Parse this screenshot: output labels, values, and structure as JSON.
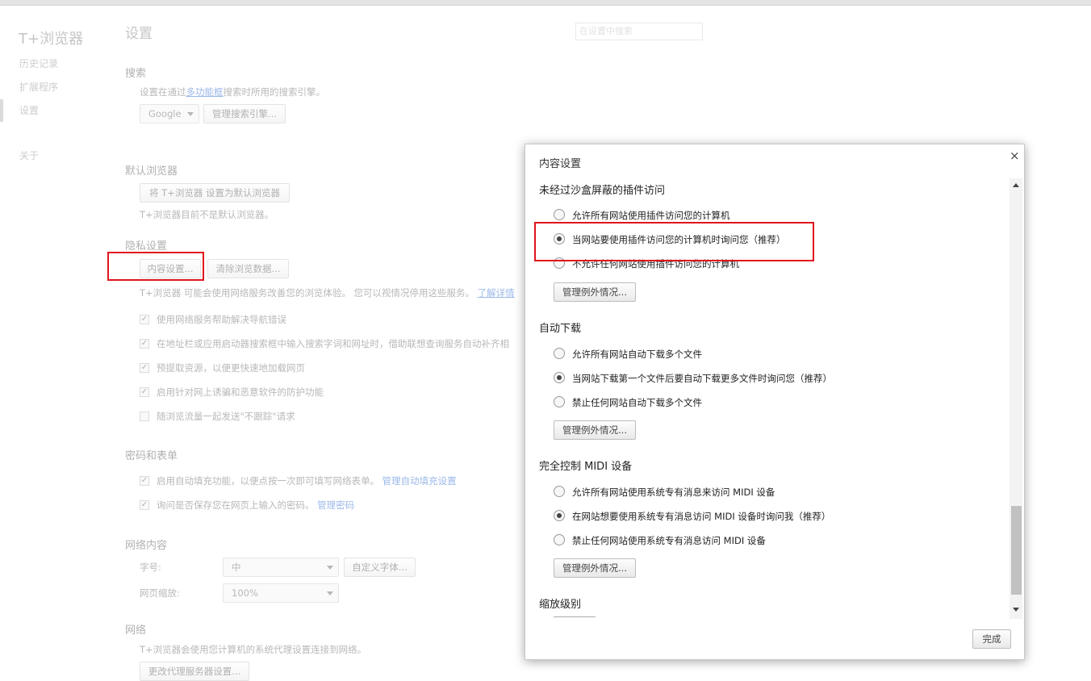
{
  "app": {
    "brand": "T+浏览器"
  },
  "sidebar": {
    "items": [
      "历史记录",
      "扩展程序",
      "设置",
      "关于"
    ]
  },
  "page": {
    "title": "设置",
    "search_placeholder": "在设置中搜索"
  },
  "search_section": {
    "title": "搜索",
    "desc_pre": "设置在通过",
    "desc_link": "多功能框",
    "desc_post": "搜索时所用的搜索引擎。",
    "engine": "Google",
    "manage": "管理搜索引擎..."
  },
  "default_browser": {
    "title": "默认浏览器",
    "button": "将 T+浏览器 设置为默认浏览器",
    "status": "T+浏览器目前不是默认浏览器。"
  },
  "privacy": {
    "title": "隐私设置",
    "content_settings": "内容设置...",
    "clear_data": "清除浏览数据...",
    "desc": "T+浏览器 可能会使用网络服务改善您的浏览体验。 您可以视情况停用这些服务。",
    "desc_link": "了解详情",
    "options": [
      {
        "label": "使用网络服务帮助解决导航错误",
        "checked": true
      },
      {
        "label": "在地址栏或应用启动器搜索框中输入搜索字词和网址时，借助联想查询服务自动补齐相",
        "checked": true
      },
      {
        "label": "预提取资源，以便更快速地加载网页",
        "checked": true
      },
      {
        "label": "启用针对网上诱骗和恶意软件的防护功能",
        "checked": true
      },
      {
        "label": "随浏览流量一起发送\"不跟踪\"请求",
        "checked": false
      }
    ]
  },
  "passwords": {
    "title": "密码和表单",
    "autofill": "启用自动填充功能，以便点按一次即可填写网络表单。",
    "autofill_link": "管理自动填充设置",
    "save_pw": "询问是否保存您在网页上输入的密码。",
    "save_pw_link": "管理密码"
  },
  "web_content": {
    "title": "网络内容",
    "font_size_label": "字号:",
    "font_size_value": "中",
    "custom_fonts": "自定义字体...",
    "zoom_label": "网页缩放:",
    "zoom_value": "100%"
  },
  "network": {
    "title": "网络",
    "desc": "T+浏览器会使用您计算机的系统代理设置连接到网络。",
    "proxy": "更改代理服务器设置..."
  },
  "dialog": {
    "title": "内容设置",
    "close": "×",
    "done": "完成",
    "manage_label": "管理例外情况...",
    "sections": [
      {
        "title": "未经过沙盒屏蔽的插件访问",
        "options": [
          {
            "label": "允许所有网站使用插件访问您的计算机",
            "selected": false
          },
          {
            "label": "当网站要使用插件访问您的计算机时询问您（推荐）",
            "selected": true
          },
          {
            "label": "不允许任何网站使用插件访问您的计算机",
            "selected": false
          }
        ]
      },
      {
        "title": "自动下载",
        "options": [
          {
            "label": "允许所有网站自动下载多个文件",
            "selected": false
          },
          {
            "label": "当网站下载第一个文件后要自动下载更多文件时询问您（推荐）",
            "selected": true
          },
          {
            "label": "禁止任何网站自动下载多个文件",
            "selected": false
          }
        ]
      },
      {
        "title": "完全控制 MIDI 设备",
        "options": [
          {
            "label": "允许所有网站使用系统专有消息来访问 MIDI 设备",
            "selected": false
          },
          {
            "label": "在网站想要使用系统专有消息访问 MIDI 设备时询问我（推荐）",
            "selected": true
          },
          {
            "label": "禁止任何网站使用系统专有消息访问 MIDI 设备",
            "selected": false
          }
        ]
      },
      {
        "title": "缩放级别",
        "options": []
      }
    ]
  },
  "annotation_color": "#e0141e"
}
